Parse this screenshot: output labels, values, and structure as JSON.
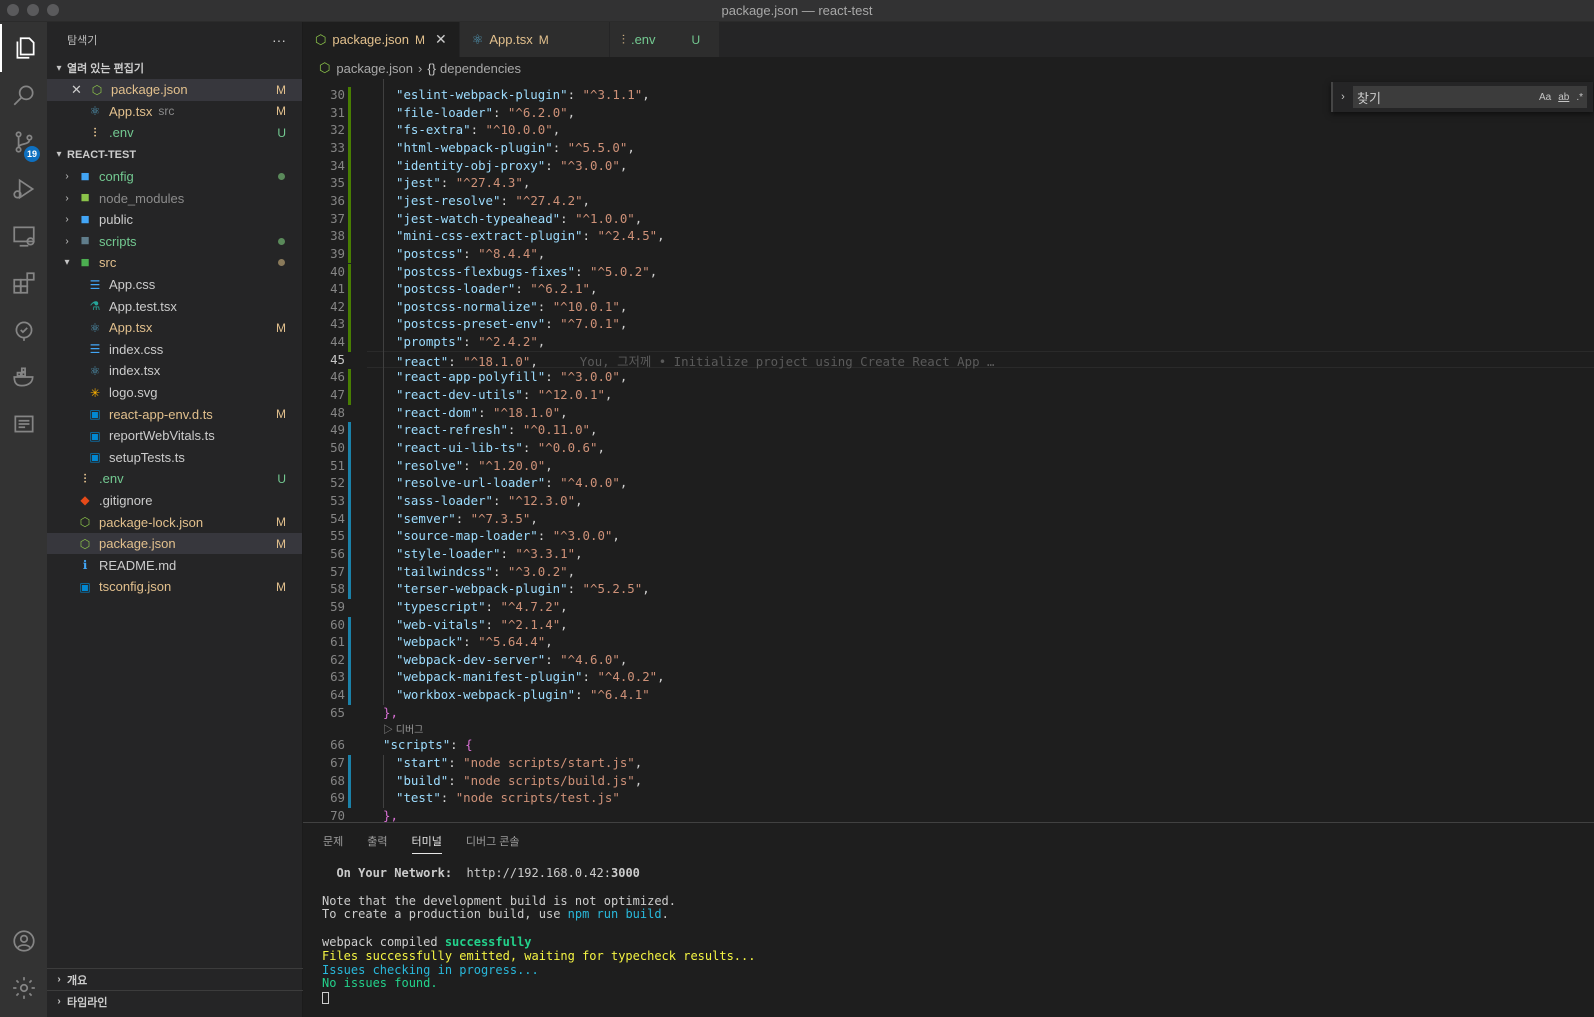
{
  "window": {
    "title": "package.json — react-test"
  },
  "activity": {
    "scm_badge": "19"
  },
  "sidebar": {
    "title": "탐색기",
    "more": "···",
    "open_editors": {
      "label": "열려 있는 편집기",
      "items": [
        {
          "name": "package.json",
          "desc": "",
          "status": "M",
          "icon": "npm-icon",
          "color": "#e2c08d",
          "iconcolor": "#8bc34a",
          "glyph": "⬡"
        },
        {
          "name": "App.tsx",
          "desc": "src",
          "status": "M",
          "icon": "react-icon",
          "color": "#e2c08d",
          "iconcolor": "#519aba",
          "glyph": "⚛"
        },
        {
          "name": ".env",
          "desc": "",
          "status": "U",
          "icon": "settings-icon",
          "color": "#73c991",
          "iconcolor": "#e2c08d",
          "glyph": "⫶"
        }
      ]
    },
    "project": {
      "label": "REACT-TEST",
      "items": [
        {
          "name": "config",
          "type": "folder",
          "indent": 1,
          "color": "#73c991",
          "status": "",
          "dot": "#5a8a5a",
          "iconcolor": "#42a5f5",
          "glyph": "▪"
        },
        {
          "name": "node_modules",
          "type": "folder",
          "indent": 1,
          "color": "#8c8c8c",
          "status": "",
          "dot": "",
          "iconcolor": "#8bc34a",
          "glyph": "▪"
        },
        {
          "name": "public",
          "type": "folder",
          "indent": 1,
          "color": "#cccccc",
          "status": "",
          "dot": "",
          "iconcolor": "#42a5f5",
          "glyph": "▪"
        },
        {
          "name": "scripts",
          "type": "folder",
          "indent": 1,
          "color": "#73c991",
          "status": "",
          "dot": "#5a8a5a",
          "iconcolor": "#607d8b",
          "glyph": "▪"
        },
        {
          "name": "src",
          "type": "folder-open",
          "indent": 1,
          "color": "#e2c08d",
          "status": "",
          "dot": "#8a7a5a",
          "iconcolor": "#4caf50",
          "glyph": "▪"
        },
        {
          "name": "App.css",
          "type": "file",
          "indent": 2,
          "color": "#cccccc",
          "status": "",
          "dot": "",
          "iconcolor": "#42a5f5",
          "glyph": "☰"
        },
        {
          "name": "App.test.tsx",
          "type": "file",
          "indent": 2,
          "color": "#cccccc",
          "status": "",
          "dot": "",
          "iconcolor": "#26a69a",
          "glyph": "⚗"
        },
        {
          "name": "App.tsx",
          "type": "file",
          "indent": 2,
          "color": "#e2c08d",
          "status": "M",
          "dot": "",
          "iconcolor": "#519aba",
          "glyph": "⚛"
        },
        {
          "name": "index.css",
          "type": "file",
          "indent": 2,
          "color": "#cccccc",
          "status": "",
          "dot": "",
          "iconcolor": "#42a5f5",
          "glyph": "☰"
        },
        {
          "name": "index.tsx",
          "type": "file",
          "indent": 2,
          "color": "#cccccc",
          "status": "",
          "dot": "",
          "iconcolor": "#519aba",
          "glyph": "⚛"
        },
        {
          "name": "logo.svg",
          "type": "file",
          "indent": 2,
          "color": "#cccccc",
          "status": "",
          "dot": "",
          "iconcolor": "#ffb300",
          "glyph": "✳"
        },
        {
          "name": "react-app-env.d.ts",
          "type": "file",
          "indent": 2,
          "color": "#e2c08d",
          "status": "M",
          "dot": "",
          "iconcolor": "#0288d1",
          "glyph": "▣"
        },
        {
          "name": "reportWebVitals.ts",
          "type": "file",
          "indent": 2,
          "color": "#cccccc",
          "status": "",
          "dot": "",
          "iconcolor": "#0288d1",
          "glyph": "▣"
        },
        {
          "name": "setupTests.ts",
          "type": "file",
          "indent": 2,
          "color": "#cccccc",
          "status": "",
          "dot": "",
          "iconcolor": "#0288d1",
          "glyph": "▣"
        },
        {
          "name": ".env",
          "type": "file",
          "indent": 1,
          "color": "#73c991",
          "status": "U",
          "dot": "",
          "iconcolor": "#e2c08d",
          "glyph": "⫶"
        },
        {
          "name": ".gitignore",
          "type": "file",
          "indent": 1,
          "color": "#cccccc",
          "status": "",
          "dot": "",
          "iconcolor": "#e64a19",
          "glyph": "◆"
        },
        {
          "name": "package-lock.json",
          "type": "file",
          "indent": 1,
          "color": "#e2c08d",
          "status": "M",
          "dot": "",
          "iconcolor": "#8bc34a",
          "glyph": "⬡"
        },
        {
          "name": "package.json",
          "type": "file",
          "indent": 1,
          "color": "#e2c08d",
          "status": "M",
          "dot": "",
          "iconcolor": "#8bc34a",
          "glyph": "⬡",
          "selected": true
        },
        {
          "name": "README.md",
          "type": "file",
          "indent": 1,
          "color": "#cccccc",
          "status": "",
          "dot": "",
          "iconcolor": "#42a5f5",
          "glyph": "ℹ"
        },
        {
          "name": "tsconfig.json",
          "type": "file",
          "indent": 1,
          "color": "#e2c08d",
          "status": "M",
          "dot": "",
          "iconcolor": "#0288d1",
          "glyph": "▣"
        }
      ]
    },
    "outline_label": "개요",
    "timeline_label": "타임라인"
  },
  "tabs": [
    {
      "label": "package.json",
      "status": "M",
      "active": true,
      "icon": "npm-icon",
      "glyph": "⬡",
      "iconcolor": "#8bc34a"
    },
    {
      "label": "App.tsx",
      "status": "M",
      "active": false,
      "icon": "react-icon",
      "glyph": "⚛",
      "iconcolor": "#519aba"
    },
    {
      "label": ".env",
      "status": "U",
      "active": false,
      "icon": "settings-icon",
      "glyph": "⫶",
      "iconcolor": "#e2c08d"
    }
  ],
  "breadcrumb": {
    "file": "package.json",
    "symbol": "dependencies"
  },
  "find": {
    "placeholder": "찾기",
    "opt_case": "Aa",
    "opt_word": "ab",
    "opt_regex": ".*"
  },
  "editor": {
    "blame": "You, 그저께 • Initialize project using Create React App …",
    "codelens": "▷ 디버그",
    "lines": [
      {
        "n": "30",
        "k": "eslint-webpack-plugin",
        "v": "^3.1.1",
        "mark": "green"
      },
      {
        "n": "31",
        "k": "file-loader",
        "v": "^6.2.0",
        "mark": "green"
      },
      {
        "n": "32",
        "k": "fs-extra",
        "v": "^10.0.0",
        "mark": "green"
      },
      {
        "n": "33",
        "k": "html-webpack-plugin",
        "v": "^5.5.0",
        "mark": "green"
      },
      {
        "n": "34",
        "k": "identity-obj-proxy",
        "v": "^3.0.0",
        "mark": "green"
      },
      {
        "n": "35",
        "k": "jest",
        "v": "^27.4.3",
        "mark": "green"
      },
      {
        "n": "36",
        "k": "jest-resolve",
        "v": "^27.4.2",
        "mark": "green"
      },
      {
        "n": "37",
        "k": "jest-watch-typeahead",
        "v": "^1.0.0",
        "mark": "green"
      },
      {
        "n": "38",
        "k": "mini-css-extract-plugin",
        "v": "^2.4.5",
        "mark": "green"
      },
      {
        "n": "39",
        "k": "postcss",
        "v": "^8.4.4",
        "mark": "green"
      },
      {
        "n": "40",
        "k": "postcss-flexbugs-fixes",
        "v": "^5.0.2",
        "mark": "green"
      },
      {
        "n": "41",
        "k": "postcss-loader",
        "v": "^6.2.1",
        "mark": "green"
      },
      {
        "n": "42",
        "k": "postcss-normalize",
        "v": "^10.0.1",
        "mark": "green"
      },
      {
        "n": "43",
        "k": "postcss-preset-env",
        "v": "^7.0.1",
        "mark": "green"
      },
      {
        "n": "44",
        "k": "prompts",
        "v": "^2.4.2",
        "mark": "green"
      },
      {
        "n": "45",
        "k": "react",
        "v": "^18.1.0",
        "mark": "",
        "current": true
      },
      {
        "n": "46",
        "k": "react-app-polyfill",
        "v": "^3.0.0",
        "mark": "green"
      },
      {
        "n": "47",
        "k": "react-dev-utils",
        "v": "^12.0.1",
        "mark": "green"
      },
      {
        "n": "48",
        "k": "react-dom",
        "v": "^18.1.0",
        "mark": ""
      },
      {
        "n": "49",
        "k": "react-refresh",
        "v": "^0.11.0",
        "mark": "blue"
      },
      {
        "n": "50",
        "k": "react-ui-lib-ts",
        "v": "^0.0.6",
        "mark": "blue"
      },
      {
        "n": "51",
        "k": "resolve",
        "v": "^1.20.0",
        "mark": "blue"
      },
      {
        "n": "52",
        "k": "resolve-url-loader",
        "v": "^4.0.0",
        "mark": "blue"
      },
      {
        "n": "53",
        "k": "sass-loader",
        "v": "^12.3.0",
        "mark": "blue"
      },
      {
        "n": "54",
        "k": "semver",
        "v": "^7.3.5",
        "mark": "blue"
      },
      {
        "n": "55",
        "k": "source-map-loader",
        "v": "^3.0.0",
        "mark": "blue"
      },
      {
        "n": "56",
        "k": "style-loader",
        "v": "^3.3.1",
        "mark": "blue"
      },
      {
        "n": "57",
        "k": "tailwindcss",
        "v": "^3.0.2",
        "mark": "blue"
      },
      {
        "n": "58",
        "k": "terser-webpack-plugin",
        "v": "^5.2.5",
        "mark": "blue"
      },
      {
        "n": "59",
        "k": "typescript",
        "v": "^4.7.2",
        "mark": ""
      },
      {
        "n": "60",
        "k": "web-vitals",
        "v": "^2.1.4",
        "mark": "blue"
      },
      {
        "n": "61",
        "k": "webpack",
        "v": "^5.64.4",
        "mark": "blue"
      },
      {
        "n": "62",
        "k": "webpack-dev-server",
        "v": "^4.6.0",
        "mark": "blue"
      },
      {
        "n": "63",
        "k": "webpack-manifest-plugin",
        "v": "^4.0.2",
        "mark": "blue"
      },
      {
        "n": "64",
        "k": "workbox-webpack-plugin",
        "v": "^6.4.1",
        "mark": "blue",
        "last": true
      }
    ],
    "close_deps": {
      "n": "65",
      "text": "},"
    },
    "scripts_open": {
      "n": "66",
      "key": "scripts"
    },
    "scripts": [
      {
        "n": "67",
        "k": "start",
        "v": "node scripts/start.js"
      },
      {
        "n": "68",
        "k": "build",
        "v": "node scripts/build.js"
      },
      {
        "n": "69",
        "k": "test",
        "v": "node scripts/test.js",
        "last": true
      }
    ],
    "close_scripts": {
      "n": "70",
      "text": "},"
    }
  },
  "panel": {
    "tabs": [
      "문제",
      "출력",
      "터미널",
      "디버그 콘솔"
    ],
    "active_tab": "터미널",
    "terminal": {
      "network_label": "On Your Network:",
      "network_url": "http://192.168.0.42:",
      "network_port": "3000",
      "note1": "Note that the development build is not optimized.",
      "note2_prefix": "To create a production build, use ",
      "note2_cmd": "npm run build",
      "note2_suffix": ".",
      "compiled_prefix": "webpack compiled ",
      "compiled_status": "successfully",
      "emitted": "Files successfully emitted, waiting for typecheck results...",
      "checking": "Issues checking in progress...",
      "no_issues": "No issues found."
    }
  }
}
